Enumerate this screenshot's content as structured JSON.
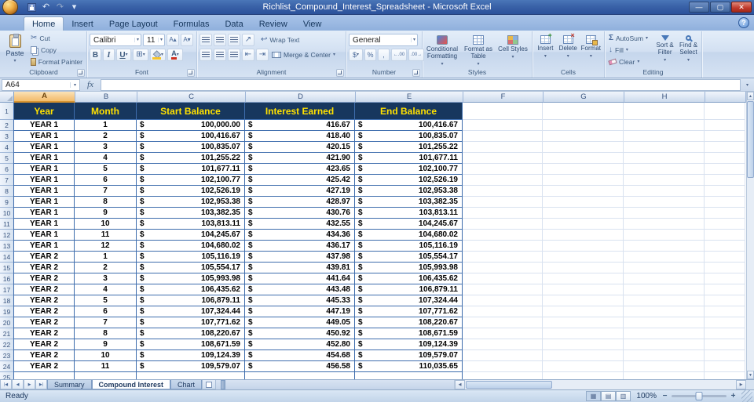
{
  "window": {
    "title": "Richlist_Compound_Interest_Spreadsheet - Microsoft Excel",
    "controls": {
      "minimize": "—",
      "maximize": "▢",
      "close": "✕"
    }
  },
  "icons": {
    "dropdown": "▾",
    "undo": "↶",
    "redo": "↷",
    "help": "?",
    "cut": "✂",
    "bold": "B",
    "italic": "I",
    "underline": "U",
    "borders": "⊞",
    "grow_font": "A▴",
    "shrink_font": "A▾",
    "orientation": "↗",
    "wrap": "↩",
    "indent_dec": "⇤",
    "indent_inc": "⇥",
    "accounting": "$",
    "percent": "%",
    "comma": ",",
    "inc_decimal": "←.00",
    "dec_decimal": ".00→",
    "sigma": "Σ",
    "fill_arrow": "↓",
    "up": "▲",
    "down": "▼",
    "left": "◀",
    "right": "▶",
    "tab_first": "|◀",
    "tab_prev": "◀",
    "tab_next": "▶",
    "tab_last": "▶|",
    "view_normal": "▦",
    "view_layout": "▤",
    "view_break": "▥",
    "zoom_out": "−",
    "zoom_in": "+"
  },
  "ribbon": {
    "tabs": [
      {
        "label": "Home",
        "active": true
      },
      {
        "label": "Insert",
        "active": false
      },
      {
        "label": "Page Layout",
        "active": false
      },
      {
        "label": "Formulas",
        "active": false
      },
      {
        "label": "Data",
        "active": false
      },
      {
        "label": "Review",
        "active": false
      },
      {
        "label": "View",
        "active": false
      }
    ],
    "clipboard": {
      "label": "Clipboard",
      "paste": "Paste",
      "cut": "Cut",
      "copy": "Copy",
      "format_painter": "Format Painter"
    },
    "font": {
      "label": "Font",
      "font_name": "Calibri",
      "font_size": "11"
    },
    "alignment": {
      "label": "Alignment",
      "wrap_text": "Wrap Text",
      "merge_center": "Merge & Center"
    },
    "number": {
      "label": "Number",
      "format": "General"
    },
    "styles": {
      "label": "Styles",
      "conditional": "Conditional Formatting",
      "format_table": "Format as Table",
      "cell_styles": "Cell Styles"
    },
    "cells": {
      "label": "Cells",
      "insert": "Insert",
      "delete": "Delete",
      "format": "Format"
    },
    "editing": {
      "label": "Editing",
      "autosum": "AutoSum",
      "fill": "Fill",
      "clear": "Clear",
      "sort_filter": "Sort & Filter",
      "find_select": "Find & Select"
    }
  },
  "formula_bar": {
    "name_box": "A64",
    "fx": "fx",
    "formula": ""
  },
  "grid": {
    "columns": [
      "A",
      "B",
      "C",
      "D",
      "E",
      "F",
      "G",
      "H"
    ],
    "selected_column": "A"
  },
  "sheet": {
    "currency": "$",
    "headers": [
      "Year",
      "Month",
      "Start Balance",
      "Interest Earned",
      "End Balance"
    ],
    "rows": [
      [
        "YEAR 1",
        "1",
        "100,000.00",
        "416.67",
        "100,416.67"
      ],
      [
        "YEAR 1",
        "2",
        "100,416.67",
        "418.40",
        "100,835.07"
      ],
      [
        "YEAR 1",
        "3",
        "100,835.07",
        "420.15",
        "101,255.22"
      ],
      [
        "YEAR 1",
        "4",
        "101,255.22",
        "421.90",
        "101,677.11"
      ],
      [
        "YEAR 1",
        "5",
        "101,677.11",
        "423.65",
        "102,100.77"
      ],
      [
        "YEAR 1",
        "6",
        "102,100.77",
        "425.42",
        "102,526.19"
      ],
      [
        "YEAR 1",
        "7",
        "102,526.19",
        "427.19",
        "102,953.38"
      ],
      [
        "YEAR 1",
        "8",
        "102,953.38",
        "428.97",
        "103,382.35"
      ],
      [
        "YEAR 1",
        "9",
        "103,382.35",
        "430.76",
        "103,813.11"
      ],
      [
        "YEAR 1",
        "10",
        "103,813.11",
        "432.55",
        "104,245.67"
      ],
      [
        "YEAR 1",
        "11",
        "104,245.67",
        "434.36",
        "104,680.02"
      ],
      [
        "YEAR 1",
        "12",
        "104,680.02",
        "436.17",
        "105,116.19"
      ],
      [
        "YEAR 2",
        "1",
        "105,116.19",
        "437.98",
        "105,554.17"
      ],
      [
        "YEAR 2",
        "2",
        "105,554.17",
        "439.81",
        "105,993.98"
      ],
      [
        "YEAR 2",
        "3",
        "105,993.98",
        "441.64",
        "106,435.62"
      ],
      [
        "YEAR 2",
        "4",
        "106,435.62",
        "443.48",
        "106,879.11"
      ],
      [
        "YEAR 2",
        "5",
        "106,879.11",
        "445.33",
        "107,324.44"
      ],
      [
        "YEAR 2",
        "6",
        "107,324.44",
        "447.19",
        "107,771.62"
      ],
      [
        "YEAR 2",
        "7",
        "107,771.62",
        "449.05",
        "108,220.67"
      ],
      [
        "YEAR 2",
        "8",
        "108,220.67",
        "450.92",
        "108,671.59"
      ],
      [
        "YEAR 2",
        "9",
        "108,671.59",
        "452.80",
        "109,124.39"
      ],
      [
        "YEAR 2",
        "10",
        "109,124.39",
        "454.68",
        "109,579.07"
      ],
      [
        "YEAR 2",
        "11",
        "109,579.07",
        "456.58",
        "110,035.65"
      ]
    ]
  },
  "sheet_tabs": {
    "tabs": [
      {
        "label": "Summary",
        "active": false
      },
      {
        "label": "Compound Interest",
        "active": true
      },
      {
        "label": "Chart",
        "active": false
      }
    ]
  },
  "status_bar": {
    "mode": "Ready",
    "zoom": "100%"
  },
  "colors": {
    "table_header_bg": "#17375E",
    "table_header_text": "#FFE100",
    "table_border": "#3E6DAD",
    "gridline": "#D9E2F0",
    "selected_column_header": "#F2BC6C",
    "titlebar_blue": "#3A62A8"
  }
}
